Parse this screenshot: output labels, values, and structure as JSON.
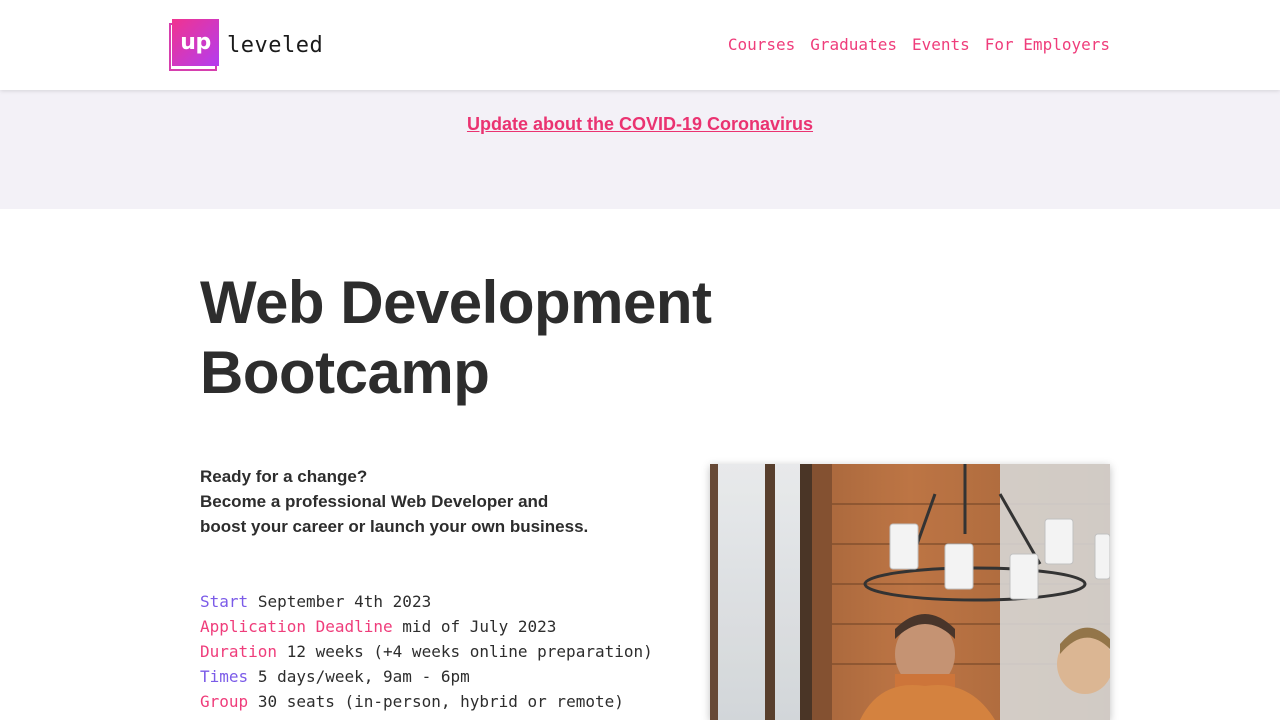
{
  "header": {
    "logo_mark": "up",
    "logo_text": "leveled",
    "nav": [
      "Courses",
      "Graduates",
      "Events",
      "For Employers"
    ]
  },
  "banner": {
    "link_text": "Update about the COVID-19 Coronavirus"
  },
  "hero": {
    "title_line1": "Web Development",
    "title_line2": "Bootcamp",
    "intro_lines": [
      "Ready for a change?",
      "Become a professional Web Developer and",
      "boost your career or launch your own business."
    ],
    "facts": [
      {
        "label": "Start",
        "value": "September 4th 2023",
        "color": "purple"
      },
      {
        "label": "Application Deadline",
        "value": "mid of July 2023",
        "color": "pink"
      },
      {
        "label": "Duration",
        "value": "12 weeks (+4 weeks online preparation)",
        "color": "pink"
      },
      {
        "label": "Times",
        "value": "5 days/week, 9am - 6pm",
        "color": "purple"
      },
      {
        "label": "Group",
        "value": "30 seats (in-person, hybrid or remote)",
        "color": "pink"
      }
    ]
  },
  "colors": {
    "accent_pink": "#ef3d7b",
    "accent_purple": "#7b5be8",
    "banner_bg": "#f3f1f7"
  }
}
